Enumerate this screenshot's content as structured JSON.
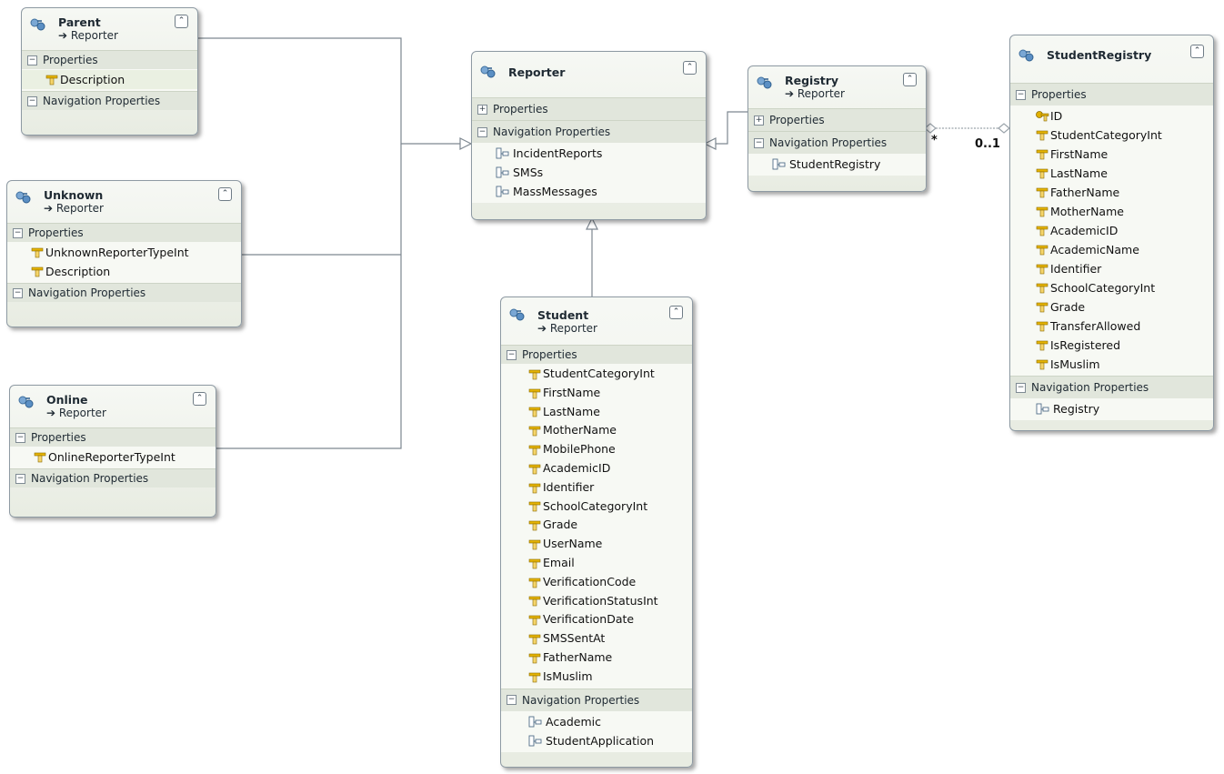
{
  "labels": {
    "properties": "Properties",
    "navigation_properties": "Navigation Properties"
  },
  "entities": {
    "parent": {
      "name": "Parent",
      "base": "➔ Reporter",
      "properties": [
        "Description"
      ],
      "navigation": []
    },
    "unknown": {
      "name": "Unknown",
      "base": "➔ Reporter",
      "properties": [
        "UnknownReporterTypeInt",
        "Description"
      ],
      "navigation": []
    },
    "online": {
      "name": "Online",
      "base": "➔ Reporter",
      "properties": [
        "OnlineReporterTypeInt"
      ],
      "navigation": []
    },
    "reporter": {
      "name": "Reporter",
      "navigation": [
        "IncidentReports",
        "SMSs",
        "MassMessages"
      ]
    },
    "registry": {
      "name": "Registry",
      "base": "➔ Reporter",
      "navigation": [
        "StudentRegistry"
      ]
    },
    "studentregistry": {
      "name": "StudentRegistry",
      "properties": [
        "ID",
        "StudentCategoryInt",
        "FirstName",
        "LastName",
        "FatherName",
        "MotherName",
        "AcademicID",
        "AcademicName",
        "Identifier",
        "SchoolCategoryInt",
        "Grade",
        "TransferAllowed",
        "IsRegistered",
        "IsMuslim"
      ],
      "navigation": [
        "Registry"
      ]
    },
    "student": {
      "name": "Student",
      "base": "➔ Reporter",
      "properties": [
        "StudentCategoryInt",
        "FirstName",
        "LastName",
        "MotherName",
        "MobilePhone",
        "AcademicID",
        "Identifier",
        "SchoolCategoryInt",
        "Grade",
        "UserName",
        "Email",
        "VerificationCode",
        "VerificationStatusInt",
        "VerificationDate",
        "SMSSentAt",
        "FatherName",
        "IsMuslim"
      ],
      "navigation": [
        "Academic",
        "StudentApplication"
      ]
    }
  },
  "association": {
    "registry_end": "*",
    "studentregistry_end": "0..1"
  },
  "colors": {
    "connector": "#7d8790",
    "association": "#9aa3aa",
    "key": "#d9a400"
  }
}
